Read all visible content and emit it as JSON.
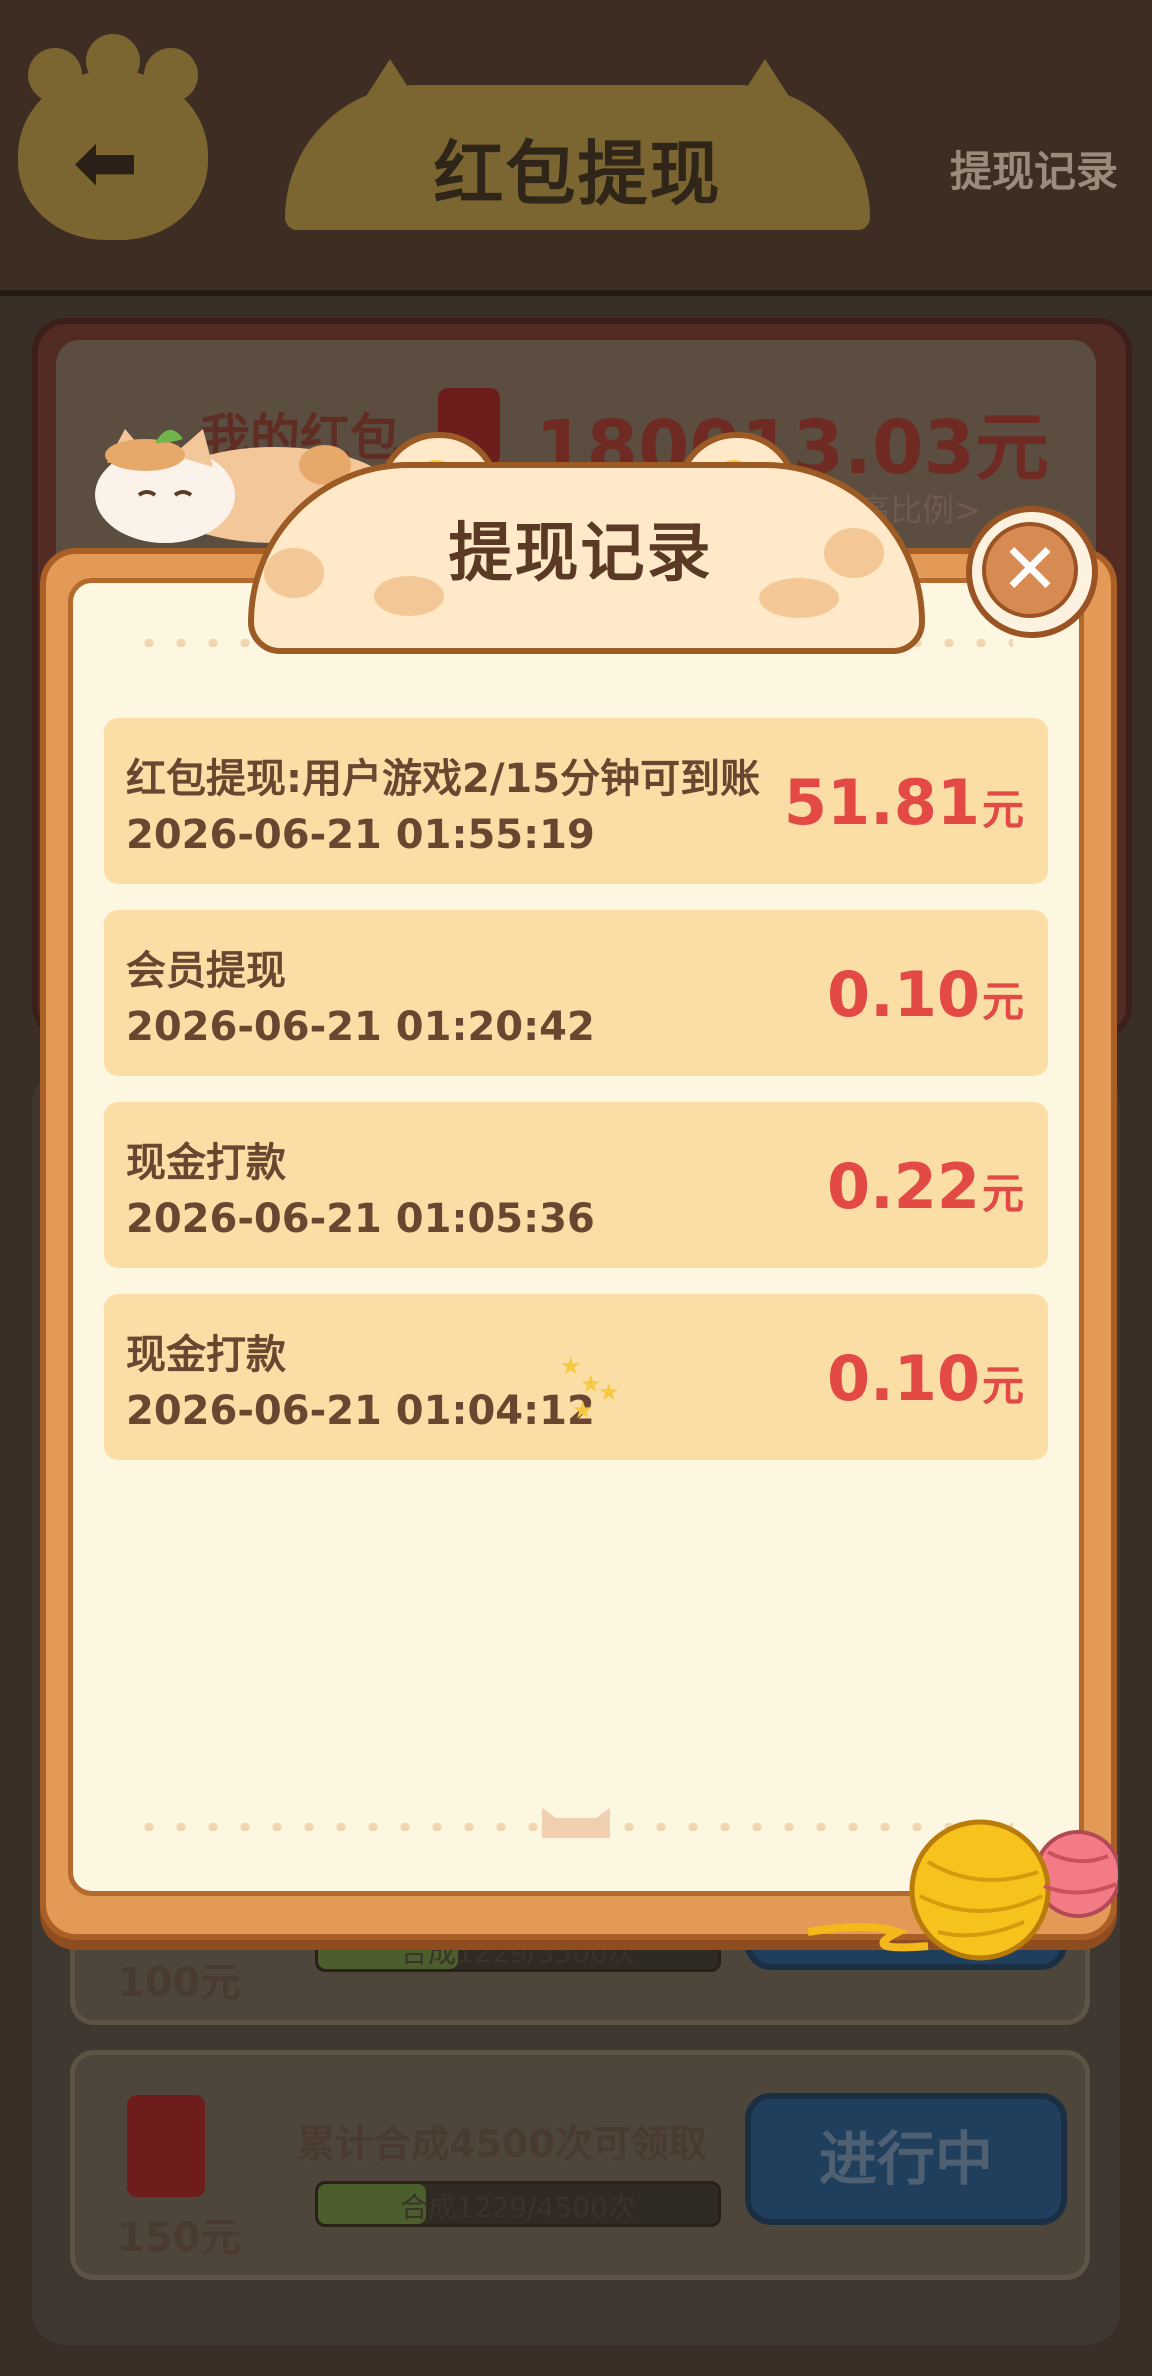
{
  "header": {
    "title": "红包提现",
    "back_icon": "arrow-left-icon",
    "record_link": "提现记录"
  },
  "balance": {
    "label": "我的红包",
    "value": "180013.03元",
    "raise_link": "提高比例>"
  },
  "tasks": [
    {
      "amount": "100元",
      "progress_text": "合成1229/3500次",
      "progress": 0.35
    },
    {
      "amount": "150元",
      "description": "累计合成4500次可领取",
      "progress_text": "合成1229/4500次",
      "progress": 0.27,
      "button": "进行中"
    }
  ],
  "modal": {
    "title": "提现记录",
    "close_icon": "close-icon",
    "records": [
      {
        "title": "红包提现:用户游戏2/15分钟可到账",
        "time": "2026-06-21 01:55:19",
        "amount": "51.81",
        "unit": "元"
      },
      {
        "title": "会员提现",
        "time": "2026-06-21 01:20:42",
        "amount": "0.10",
        "unit": "元"
      },
      {
        "title": "现金打款",
        "time": "2026-06-21 01:05:36",
        "amount": "0.22",
        "unit": "元"
      },
      {
        "title": "现金打款",
        "time": "2026-06-21 01:04:12",
        "amount": "0.10",
        "unit": "元"
      }
    ]
  },
  "colors": {
    "amount_red": "#e34a46",
    "row_bg": "#fbdda6",
    "modal_frame": "#e39a56",
    "modal_bg": "#fdf6e1"
  }
}
